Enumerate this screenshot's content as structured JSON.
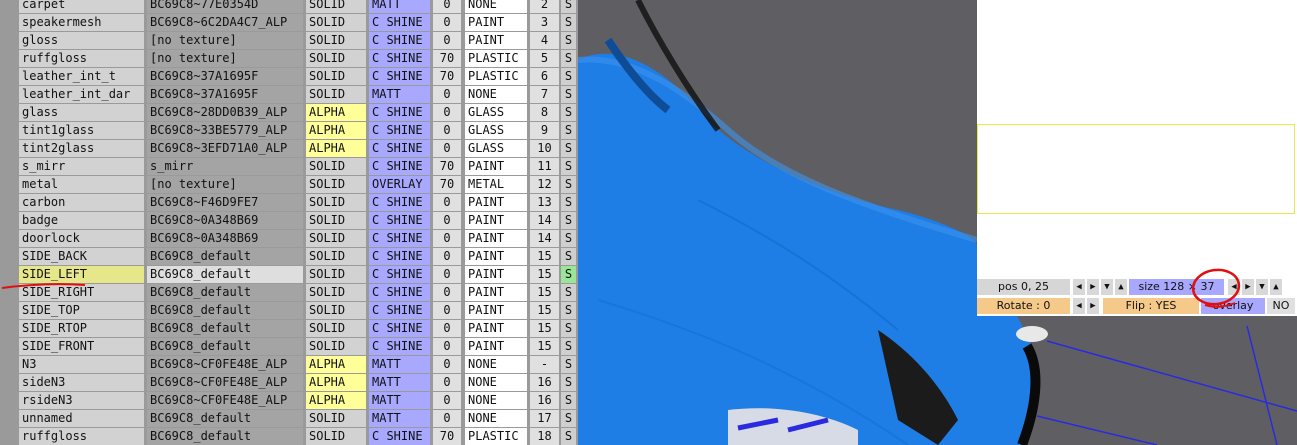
{
  "materials": [
    {
      "name": "carpet",
      "texture": "BC69C8~77E0354D",
      "blend": "SOLID",
      "shader": "MATT",
      "value": "0",
      "type": "NONE",
      "num": "2",
      "s": "S"
    },
    {
      "name": "speakermesh",
      "texture": "BC69C8~6C2DA4C7_ALP",
      "blend": "SOLID",
      "shader": "C SHINE",
      "value": "0",
      "type": "PAINT",
      "num": "3",
      "s": "S"
    },
    {
      "name": "gloss",
      "texture": "[no texture]",
      "blend": "SOLID",
      "shader": "C SHINE",
      "value": "0",
      "type": "PAINT",
      "num": "4",
      "s": "S"
    },
    {
      "name": "ruffgloss",
      "texture": "[no texture]",
      "blend": "SOLID",
      "shader": "C SHINE",
      "value": "70",
      "type": "PLASTIC",
      "num": "5",
      "s": "S"
    },
    {
      "name": "leather_int_t",
      "texture": "BC69C8~37A1695F",
      "blend": "SOLID",
      "shader": "C SHINE",
      "value": "70",
      "type": "PLASTIC",
      "num": "6",
      "s": "S"
    },
    {
      "name": "leather_int_dar",
      "texture": "BC69C8~37A1695F",
      "blend": "SOLID",
      "shader": "MATT",
      "value": "0",
      "type": "NONE",
      "num": "7",
      "s": "S"
    },
    {
      "name": "glass",
      "texture": "BC69C8~28DD0B39_ALP",
      "blend": "ALPHA",
      "shader": "C SHINE",
      "value": "0",
      "type": "GLASS",
      "num": "8",
      "s": "S"
    },
    {
      "name": "tint1glass",
      "texture": "BC69C8~33BE5779_ALP",
      "blend": "ALPHA",
      "shader": "C SHINE",
      "value": "0",
      "type": "GLASS",
      "num": "9",
      "s": "S"
    },
    {
      "name": "tint2glass",
      "texture": "BC69C8~3EFD71A0_ALP",
      "blend": "ALPHA",
      "shader": "C SHINE",
      "value": "0",
      "type": "GLASS",
      "num": "10",
      "s": "S"
    },
    {
      "name": "s_mirr",
      "texture": "s_mirr",
      "blend": "SOLID",
      "shader": "C SHINE",
      "value": "70",
      "type": "PAINT",
      "num": "11",
      "s": "S"
    },
    {
      "name": "metal",
      "texture": "[no texture]",
      "blend": "SOLID",
      "shader": "OVERLAY",
      "value": "70",
      "type": "METAL",
      "num": "12",
      "s": "S"
    },
    {
      "name": "carbon",
      "texture": "BC69C8~F46D9FE7",
      "blend": "SOLID",
      "shader": "C SHINE",
      "value": "0",
      "type": "PAINT",
      "num": "13",
      "s": "S"
    },
    {
      "name": "badge",
      "texture": "BC69C8~0A348B69",
      "blend": "SOLID",
      "shader": "C SHINE",
      "value": "0",
      "type": "PAINT",
      "num": "14",
      "s": "S"
    },
    {
      "name": "doorlock",
      "texture": "BC69C8~0A348B69",
      "blend": "SOLID",
      "shader": "C SHINE",
      "value": "0",
      "type": "PAINT",
      "num": "14",
      "s": "S"
    },
    {
      "name": "SIDE_BACK",
      "texture": "BC69C8_default",
      "blend": "SOLID",
      "shader": "C SHINE",
      "value": "0",
      "type": "PAINT",
      "num": "15",
      "s": "S"
    },
    {
      "name": "SIDE_LEFT",
      "texture": "BC69C8_default",
      "blend": "SOLID",
      "shader": "C SHINE",
      "value": "0",
      "type": "PAINT",
      "num": "15",
      "s": "S",
      "selected": true
    },
    {
      "name": "SIDE_RIGHT",
      "texture": "BC69C8_default",
      "blend": "SOLID",
      "shader": "C SHINE",
      "value": "0",
      "type": "PAINT",
      "num": "15",
      "s": "S"
    },
    {
      "name": "SIDE_TOP",
      "texture": "BC69C8_default",
      "blend": "SOLID",
      "shader": "C SHINE",
      "value": "0",
      "type": "PAINT",
      "num": "15",
      "s": "S"
    },
    {
      "name": "SIDE_RTOP",
      "texture": "BC69C8_default",
      "blend": "SOLID",
      "shader": "C SHINE",
      "value": "0",
      "type": "PAINT",
      "num": "15",
      "s": "S"
    },
    {
      "name": "SIDE_FRONT",
      "texture": "BC69C8_default",
      "blend": "SOLID",
      "shader": "C SHINE",
      "value": "0",
      "type": "PAINT",
      "num": "15",
      "s": "S"
    },
    {
      "name": "N3",
      "texture": "BC69C8~CF0FE48E_ALP",
      "blend": "ALPHA",
      "shader": "MATT",
      "value": "0",
      "type": "NONE",
      "num": "-",
      "s": "S"
    },
    {
      "name": "sideN3",
      "texture": "BC69C8~CF0FE48E_ALP",
      "blend": "ALPHA",
      "shader": "MATT",
      "value": "0",
      "type": "NONE",
      "num": "16",
      "s": "S"
    },
    {
      "name": "rsideN3",
      "texture": "BC69C8~CF0FE48E_ALP",
      "blend": "ALPHA",
      "shader": "MATT",
      "value": "0",
      "type": "NONE",
      "num": "16",
      "s": "S"
    },
    {
      "name": "unnamed",
      "texture": "BC69C8_default",
      "blend": "SOLID",
      "shader": "MATT",
      "value": "0",
      "type": "NONE",
      "num": "17",
      "s": "S"
    },
    {
      "name": "ruffgloss",
      "texture": "BC69C8_default",
      "blend": "SOLID",
      "shader": "C SHINE",
      "value": "70",
      "type": "PLASTIC",
      "num": "18",
      "s": "S"
    }
  ],
  "controls": {
    "pos": "pos 0, 25",
    "size": "size 128 × 37",
    "rotate": "Rotate : 0",
    "flip": "Flip : YES",
    "overlay": "overlay",
    "no": "NO"
  },
  "colors": {
    "car_paint": "#1e7ee6",
    "ground": "#5f5f63",
    "sky": "#ffffff",
    "wire": "#2a2ae0",
    "annotation": "#e01010"
  }
}
